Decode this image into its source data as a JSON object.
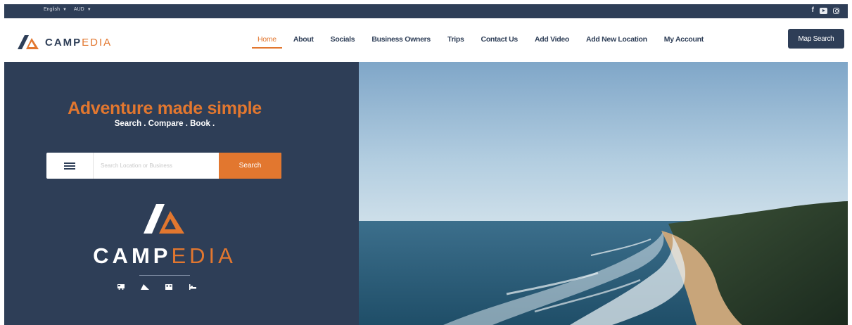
{
  "topbar": {
    "language": "English",
    "currency": "AUD",
    "social_icons": [
      "facebook-icon",
      "youtube-icon",
      "instagram-icon"
    ]
  },
  "header": {
    "logo_text_main": "CAMP",
    "logo_text_accent": "EDIA",
    "nav": [
      {
        "label": "Home",
        "active": true
      },
      {
        "label": "About"
      },
      {
        "label": "Socials"
      },
      {
        "label": "Business Owners"
      },
      {
        "label": "Trips"
      },
      {
        "label": "Contact Us"
      },
      {
        "label": "Add Video"
      },
      {
        "label": "Add New Location"
      },
      {
        "label": "My Account"
      }
    ],
    "map_search_label": "Map Search"
  },
  "hero": {
    "headline": "Adventure made simple",
    "tagline": "Search . Compare . Book .",
    "search": {
      "placeholder": "Search Location or Business",
      "button_label": "Search"
    },
    "brand_main": "CAMP",
    "brand_accent": "EDIA",
    "amenity_icons": [
      "campervan-icon",
      "tent-icon",
      "cabin-icon",
      "bed-icon"
    ]
  },
  "colors": {
    "navy": "#2e3e57",
    "orange": "#e2772f"
  }
}
